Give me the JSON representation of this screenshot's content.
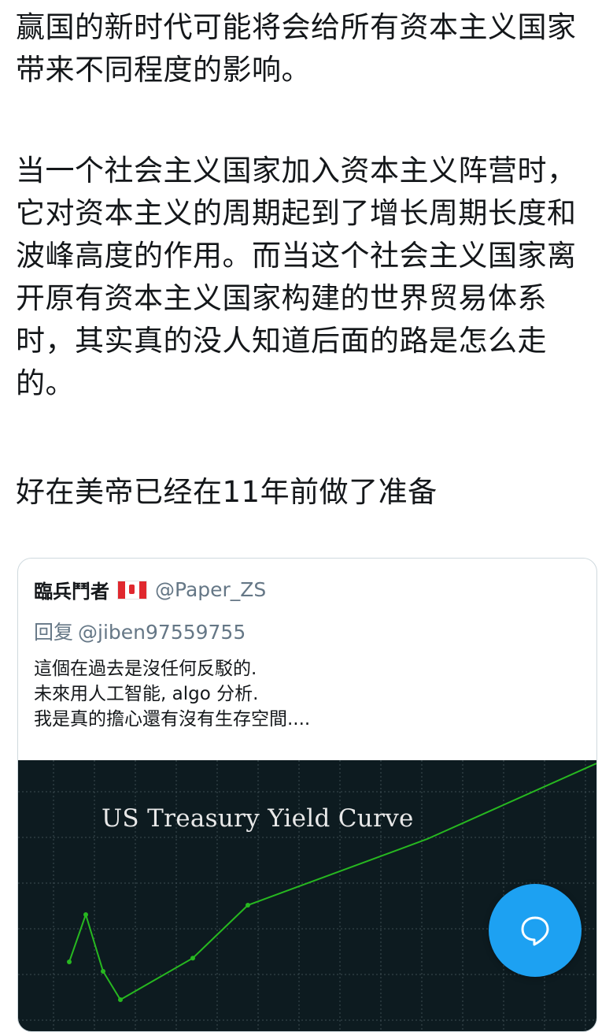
{
  "tweet": {
    "paragraph1": "赢国的新时代可能将会给所有资本主义国家带来不同程度的影响。",
    "paragraph2": "当一个社会主义国家加入资本主义阵营时，它对资本主义的周期起到了增长周期长度和波峰高度的作用。而当这个社会主义国家离开原有资本主义国家构建的世界贸易体系时，其实真的没人知道后面的路是怎么走的。",
    "paragraph3": "好在美帝已经在11年前做了准备"
  },
  "quoted_tweet": {
    "author_name": "臨兵鬥者",
    "flag_icon": "canada-flag-icon",
    "handle": "@Paper_ZS",
    "reply_prefix": "回复",
    "reply_to": "@jiben97559755",
    "lines": [
      "這個在過去是沒任何反駁的.",
      "未來用人工智能, algo 分析.",
      "我是真的擔心還有沒有生存空間...."
    ],
    "image": {
      "title": "US Treasury Yield Curve"
    }
  },
  "chart_data": {
    "type": "line",
    "title": "US Treasury Yield Curve",
    "series": [
      {
        "values": [
          0.1,
          0.35,
          0.05,
          -0.1,
          0.12,
          0.4,
          0.75,
          1.15
        ]
      }
    ],
    "grid": true,
    "line_color": "#27b820",
    "background": "#0d1b20"
  },
  "fab": {
    "icon": "compose-bubble-icon"
  },
  "colors": {
    "accent": "#1da1f2",
    "secondary_text": "#657786"
  }
}
